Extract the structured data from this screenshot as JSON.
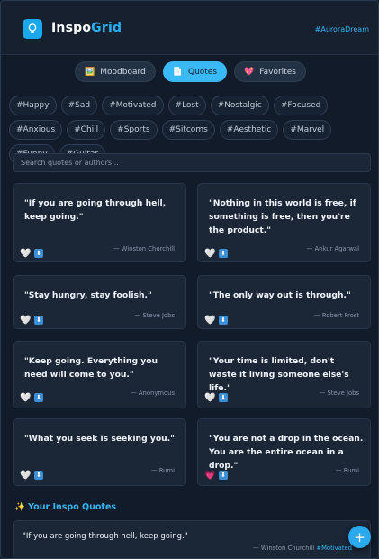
{
  "header": {
    "brand_prefix": "Inspo",
    "brand_suffix": "Grid",
    "tag": "#AuroraDream"
  },
  "tabs": [
    {
      "label": "Moodboard",
      "icon": "🖼️",
      "active": false
    },
    {
      "label": "Quotes",
      "icon": "📄",
      "active": true
    },
    {
      "label": "Favorites",
      "icon": "💖",
      "active": false
    }
  ],
  "hashtags": [
    "#Happy",
    "#Sad",
    "#Motivated",
    "#Lost",
    "#Nostalgic",
    "#Focused",
    "#Anxious",
    "#Chill",
    "#Sports",
    "#Sitcoms",
    "#Aesthetic",
    "#Marvel",
    "#Funny",
    "#Guitar"
  ],
  "search": {
    "placeholder": "Search quotes or authors..."
  },
  "quotes": [
    {
      "text": "\"If you are going through hell, keep going.\"",
      "author": "— Winston Churchill",
      "liked": false
    },
    {
      "text": "\"Nothing in this world is free, if something is free, then you're the product.\"",
      "author": "— Ankur Agarwal",
      "liked": false
    },
    {
      "text": "\"Stay hungry, stay foolish.\"",
      "author": "— Steve Jobs",
      "liked": false
    },
    {
      "text": "\"The only way out is through.\"",
      "author": "— Robert Frost",
      "liked": false
    },
    {
      "text": "\"Keep going. Everything you need will come to you.\"",
      "author": "— Anonymous",
      "liked": false
    },
    {
      "text": "\"Your time is limited, don't waste it living someone else's life.\"",
      "author": "— Steve Jobs",
      "liked": false
    },
    {
      "text": "\"What you seek is seeking you.\"",
      "author": "— Rumi",
      "liked": false
    },
    {
      "text": "\"You are not a drop in the ocean. You are the entire ocean in a drop.\"",
      "author": "— Rumi",
      "liked": true
    }
  ],
  "section": {
    "title": "Your Inspo Quotes",
    "icon": "✨"
  },
  "my_quote": {
    "text": "\"If you are going through hell, keep going.\"",
    "author": "— Winston Churchill",
    "tag": "#Motivated"
  },
  "fab_label": "+",
  "colors": {
    "accent": "#26b0f0",
    "background": "#121b29",
    "card": "#1b2636"
  }
}
